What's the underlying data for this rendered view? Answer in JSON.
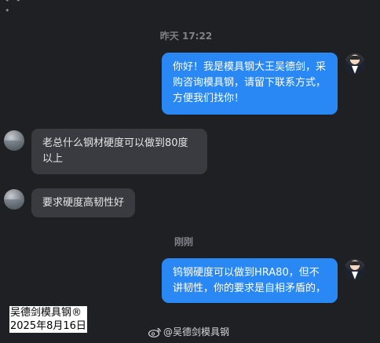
{
  "timestamps": {
    "first": "昨天 17:22",
    "second": "刚刚"
  },
  "messages": [
    {
      "side": "outgoing",
      "avatar": "businessman-avatar",
      "text": "你好！我是模具钢大王吴德剑，采购咨询模具钢，请留下联系方式，方便我们找你！"
    },
    {
      "side": "incoming",
      "avatar": "globe-avatar",
      "text": "老总什么钢材硬度可以做到80度以上"
    },
    {
      "side": "incoming",
      "avatar": "globe-avatar",
      "text": "要求硬度高韧性好"
    },
    {
      "side": "outgoing",
      "avatar": "businessman-avatar",
      "text": "钨钢硬度可以做到HRA80，但不讲韧性，你的要求是自相矛盾的，"
    }
  ],
  "watermark": {
    "brand": "吴德剑模具钢®",
    "date": "2025年8月16日",
    "weibo_handle": "@吴德剑模具钢",
    "weibo_icon": "weibo-icon"
  },
  "colors": {
    "background": "#1f2024",
    "outgoing_bubble": "#2a88f4",
    "incoming_bubble": "#3a3b40",
    "timestamp": "#7f8188"
  }
}
